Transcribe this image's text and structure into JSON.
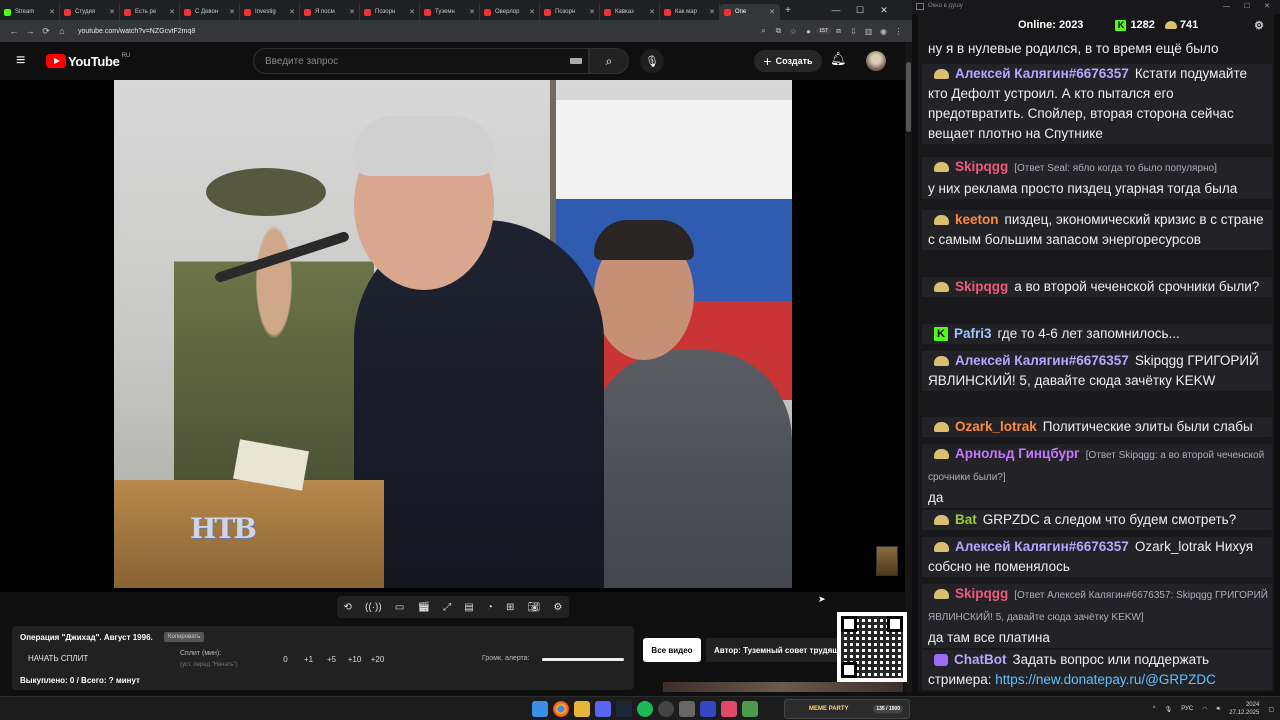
{
  "browser": {
    "tabs": [
      {
        "label": "Stream",
        "kind": "kick"
      },
      {
        "label": "Студия",
        "kind": "yt"
      },
      {
        "label": "Есть ре",
        "kind": "yt"
      },
      {
        "label": "С Девон",
        "kind": "yt"
      },
      {
        "label": "Investig",
        "kind": "yt"
      },
      {
        "label": "Я посм",
        "kind": "yt"
      },
      {
        "label": "Позорн",
        "kind": "yt"
      },
      {
        "label": "Туземн",
        "kind": "yt"
      },
      {
        "label": "Оверлор",
        "kind": "yt"
      },
      {
        "label": "Позорн",
        "kind": "yt"
      },
      {
        "label": "Кавказ",
        "kind": "yt"
      },
      {
        "label": "Как мар",
        "kind": "yt"
      },
      {
        "label": "Опе",
        "kind": "yt",
        "active": true
      }
    ],
    "url": "youtube.com/watch?v=NZGcvtF2mq8",
    "extension_badge": "157"
  },
  "youtube": {
    "logo_text": "YouTube",
    "region": "RU",
    "search_placeholder": "Введите запрос",
    "create_label": "Создать"
  },
  "video": {
    "channel_logo": "НТВ"
  },
  "plugin": {
    "title": "Операция \"Джихад\". Август 1996.",
    "copy_label": "Копировать",
    "start_split": "НАЧАТЬ СПЛИТ",
    "split_label": "Сплит (мин):",
    "split_sub": "(уст. перед \"Начать\")",
    "split_values": [
      "0",
      "+1",
      "+5",
      "+10",
      "+20"
    ],
    "alert_label": "Громк. алерта:",
    "alert_volume": 1.0,
    "bought": "Выкуплено: 0 / Всего: ? минут",
    "all_video": "Все видео",
    "author": "Автор: Туземный совет трудящихся"
  },
  "chat_header": {
    "window_title": "Окно в душу",
    "online_label": "Online:",
    "online_count": "2023",
    "kick_count": "1282",
    "crown_count": "741"
  },
  "chat": [
    {
      "badge": "none",
      "nick": "",
      "nick_color": "#efeff1",
      "reply": "",
      "text": "ну я в нулевые родился, в то время ещё было"
    },
    {
      "badge": "crown",
      "nick": "Алексей Калягин#6676357",
      "nick_color": "#b9a6ff",
      "reply": "",
      "text": "Кстати подумайте кто Дефолт устроил. А кто пытался его предотвратить. Спойлер, вторая сторона сейчас вещает плотно на Спутнике"
    },
    {
      "badge": "crown",
      "nick": "Skipqgg",
      "nick_color": "#f05a7e",
      "reply": "[Ответ Seal: яблo когда то было популярно]",
      "text": "у них реклама просто пиздец угарная тогда была"
    },
    {
      "badge": "crown",
      "nick": "keeton",
      "nick_color": "#ff8a3d",
      "reply": "",
      "text": "пиздец, экономический кризис в с стране с самым большим запасом энергоресурсов"
    },
    {
      "badge": "crown",
      "nick": "Skipqgg",
      "nick_color": "#f05a7e",
      "reply": "",
      "text": "а во второй чеченской срочники были?"
    },
    {
      "badge": "kick",
      "nick": "Pafri3",
      "nick_color": "#a2c5ff",
      "reply": "",
      "text": "где то 4-6 лет запомнилось..."
    },
    {
      "badge": "crown",
      "nick": "Алексей Калягин#6676357",
      "nick_color": "#b9a6ff",
      "reply": "",
      "text": "Skipqgg ГРИГОРИЙ ЯВЛИНСКИЙ! 5, давайте сюда зачётку KEKW"
    },
    {
      "badge": "crown",
      "nick": "Ozark_lotrak",
      "nick_color": "#ff8a3d",
      "reply": "",
      "text": "Политические элиты были слабы"
    },
    {
      "badge": "crown",
      "nick": "Арнольд Гинцбург",
      "nick_color": "#c678ff",
      "reply": "[Ответ Skipqgg: а во второй чеченской срочники были?]",
      "text": "да"
    },
    {
      "badge": "crown",
      "nick": "Bat",
      "nick_color": "#9acd32",
      "reply": "",
      "text": "GRPZDC а следом что будем смотреть?"
    },
    {
      "badge": "crown",
      "nick": "Алексей Калягин#6676357",
      "nick_color": "#b9a6ff",
      "reply": "",
      "text": "Ozark_lotrak Нихуя собсно не поменялось"
    },
    {
      "badge": "crown",
      "nick": "Skipqgg",
      "nick_color": "#f05a7e",
      "reply": "[Ответ Алексей Калягин#6676357: Skipqgg ГРИГОРИЙ ЯВЛИНСКИЙ! 5, давайте сюда зачётку KEKW]",
      "text": "да там все платина"
    },
    {
      "badge": "bot",
      "nick": "ChatBot",
      "nick_color": "#b9a6ff",
      "reply": "",
      "text": "Задать вопрос или поддержать стримера: ",
      "link": "https://new.donatepay.ru/@GRPZDC"
    }
  ],
  "taskbar": {
    "game_title": "MEME PARTY",
    "game_progress": "135 / 1500",
    "lang": "РУС",
    "time": "2024",
    "date": "27.12.2025"
  }
}
